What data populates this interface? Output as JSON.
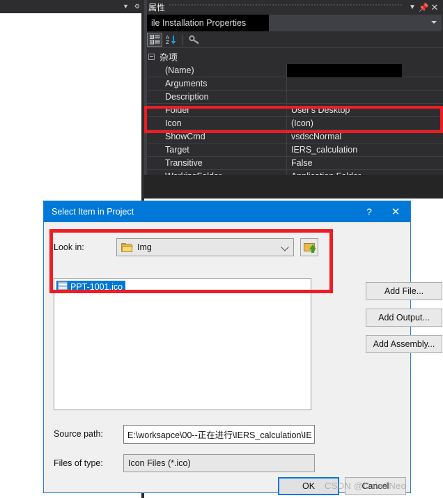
{
  "left_panel": {
    "dropdown_icon": "chevron-down-icon",
    "settings_icon": "gear-icon"
  },
  "properties_panel": {
    "title": "属性",
    "title_icons": {
      "dropdown": "chevron-down-icon",
      "pin": "pin-icon",
      "close": "close-icon"
    },
    "object_combo": {
      "value": "ile Installation Properties",
      "redacted": true
    },
    "toolbar": {
      "categorized_label": "categorized-view-icon",
      "alphabetical_label": "alphabetical-sort-icon",
      "property_pages_label": "property-pages-icon"
    },
    "category": "杂项",
    "rows": [
      {
        "name": "(Name)",
        "value": "",
        "redacted": true
      },
      {
        "name": "Arguments",
        "value": ""
      },
      {
        "name": "Description",
        "value": ""
      },
      {
        "name": "Folder",
        "value": "User's Desktop"
      },
      {
        "name": "Icon",
        "value": "(Icon)"
      },
      {
        "name": "ShowCmd",
        "value": "vsdscNormal"
      },
      {
        "name": "Target",
        "value": "IERS_calculation"
      },
      {
        "name": "Transitive",
        "value": "False"
      },
      {
        "name": "WorkingFolder",
        "value": "Application Folder"
      }
    ]
  },
  "dialog": {
    "title": "Select Item in Project",
    "help_label": "?",
    "close_label": "✕",
    "look_in_label": "Look in:",
    "look_in_value": "Img",
    "up_one_level_icon": "folder-up-icon",
    "files": [
      {
        "name": "PPT-1001.ico",
        "icon": "ico-file-icon",
        "selected": true
      }
    ],
    "side_buttons": [
      {
        "label": "Add File..."
      },
      {
        "label": "Add Output..."
      },
      {
        "label": "Add Assembly..."
      }
    ],
    "source_path_label": "Source path:",
    "source_path_value": "E:\\worksapce\\00--正在进行\\IERS_calculation\\IE",
    "files_of_type_label": "Files of type:",
    "files_of_type_value": "Icon Files (*.ico)",
    "ok_label": "OK",
    "cancel_label": "Cancel"
  },
  "watermark": "CSDN @Cola&Neo",
  "colors": {
    "accent_blue": "#0078d7",
    "highlight_red": "#ee1c25",
    "panel_dark": "#2d2d30",
    "dialog_bg": "#f0f0f0"
  }
}
